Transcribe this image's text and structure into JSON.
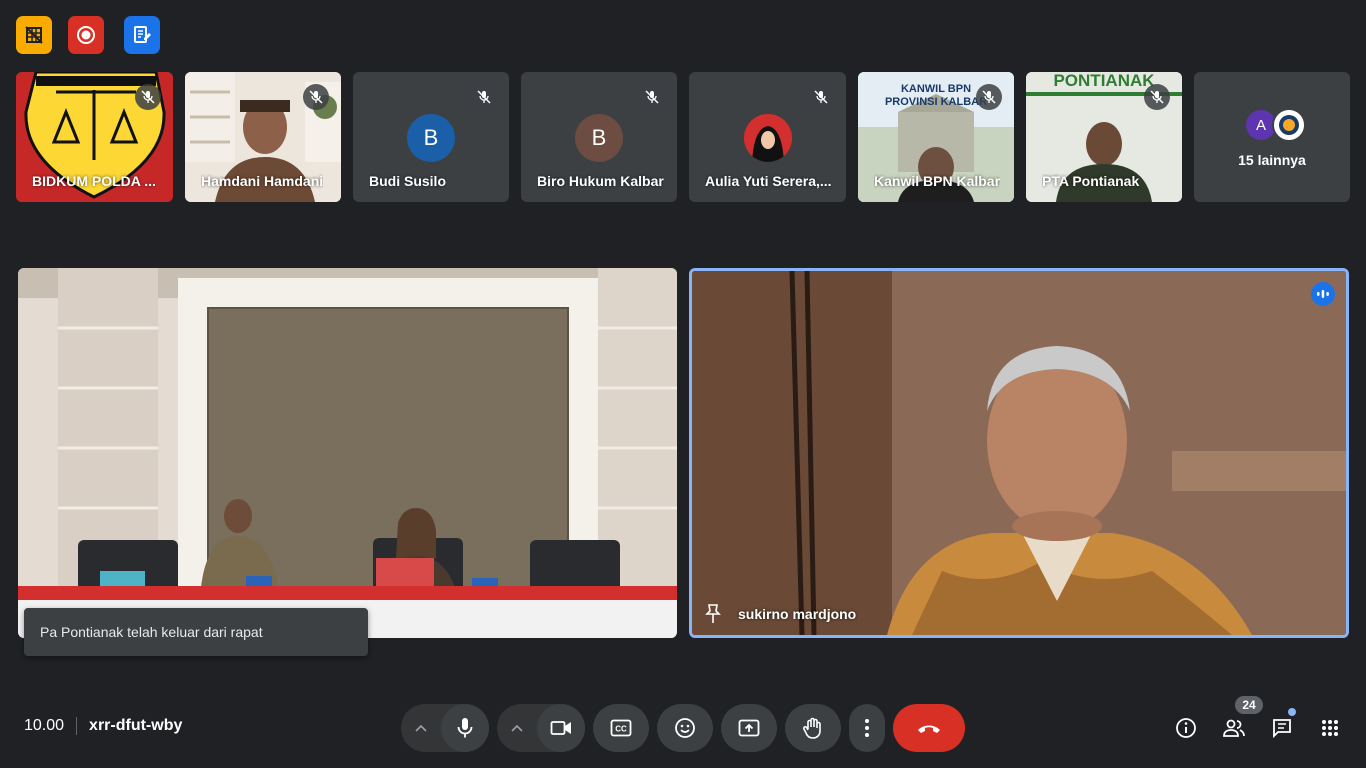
{
  "participants": [
    {
      "name": "BIDKUM POLDA ..."
    },
    {
      "name": "Hamdani Hamdani"
    },
    {
      "name": "Budi Susilo",
      "initial": "B",
      "color": "#1a5fa8"
    },
    {
      "name": "Biro Hukum Kalbar",
      "initial": "B",
      "color": "#6d4c41"
    },
    {
      "name": "Aulia Yuti Serera,..."
    },
    {
      "name": "Kanwil BPN Kalbar",
      "banner_line1": "KANWIL BPN",
      "banner_line2": "PROVINSI KALBAR"
    },
    {
      "name": "PTA Pontianak",
      "banner": "PONTIANAK"
    }
  ],
  "others": {
    "label": "15 lainnya",
    "initial": "A",
    "color": "#5e35b1"
  },
  "main_tiles": {
    "left_name": "",
    "right_name": "sukirno mardjono"
  },
  "toast": "Pa Pontianak telah keluar dari rapat",
  "meeting": {
    "time": "10.00",
    "code": "xrr-dfut-wby"
  },
  "people_count": "24",
  "colors": {
    "end_call": "#d93025",
    "active_border": "#8ab4f8",
    "speaking": "#1a73e8"
  }
}
